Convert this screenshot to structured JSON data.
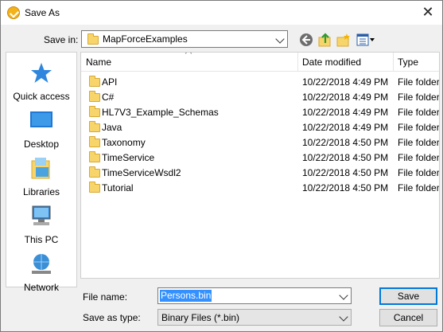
{
  "window": {
    "title": "Save As"
  },
  "toolbar": {
    "save_in_label": "Save in:",
    "save_in_value": "MapForceExamples"
  },
  "places": [
    {
      "label": "Quick access",
      "icon": "quick-access-icon"
    },
    {
      "label": "Desktop",
      "icon": "desktop-icon"
    },
    {
      "label": "Libraries",
      "icon": "libraries-icon"
    },
    {
      "label": "This PC",
      "icon": "this-pc-icon"
    },
    {
      "label": "Network",
      "icon": "network-icon"
    }
  ],
  "columns": {
    "name": "Name",
    "date": "Date modified",
    "type": "Type"
  },
  "files": [
    {
      "name": "API",
      "date": "10/22/2018 4:49 PM",
      "type": "File folder"
    },
    {
      "name": "C#",
      "date": "10/22/2018 4:49 PM",
      "type": "File folder"
    },
    {
      "name": "HL7V3_Example_Schemas",
      "date": "10/22/2018 4:49 PM",
      "type": "File folder"
    },
    {
      "name": "Java",
      "date": "10/22/2018 4:49 PM",
      "type": "File folder"
    },
    {
      "name": "Taxonomy",
      "date": "10/22/2018 4:50 PM",
      "type": "File folder"
    },
    {
      "name": "TimeService",
      "date": "10/22/2018 4:50 PM",
      "type": "File folder"
    },
    {
      "name": "TimeServiceWsdl2",
      "date": "10/22/2018 4:50 PM",
      "type": "File folder"
    },
    {
      "name": "Tutorial",
      "date": "10/22/2018 4:50 PM",
      "type": "File folder"
    }
  ],
  "form": {
    "file_name_label": "File name:",
    "file_name_value": "Persons.bin",
    "type_label": "Save as type:",
    "type_value": "Binary Files (*.bin)"
  },
  "buttons": {
    "save": "Save",
    "cancel": "Cancel"
  },
  "colors": {
    "accent": "#0078d7",
    "selection": "#3390ff",
    "folder": "#f7d56a"
  }
}
